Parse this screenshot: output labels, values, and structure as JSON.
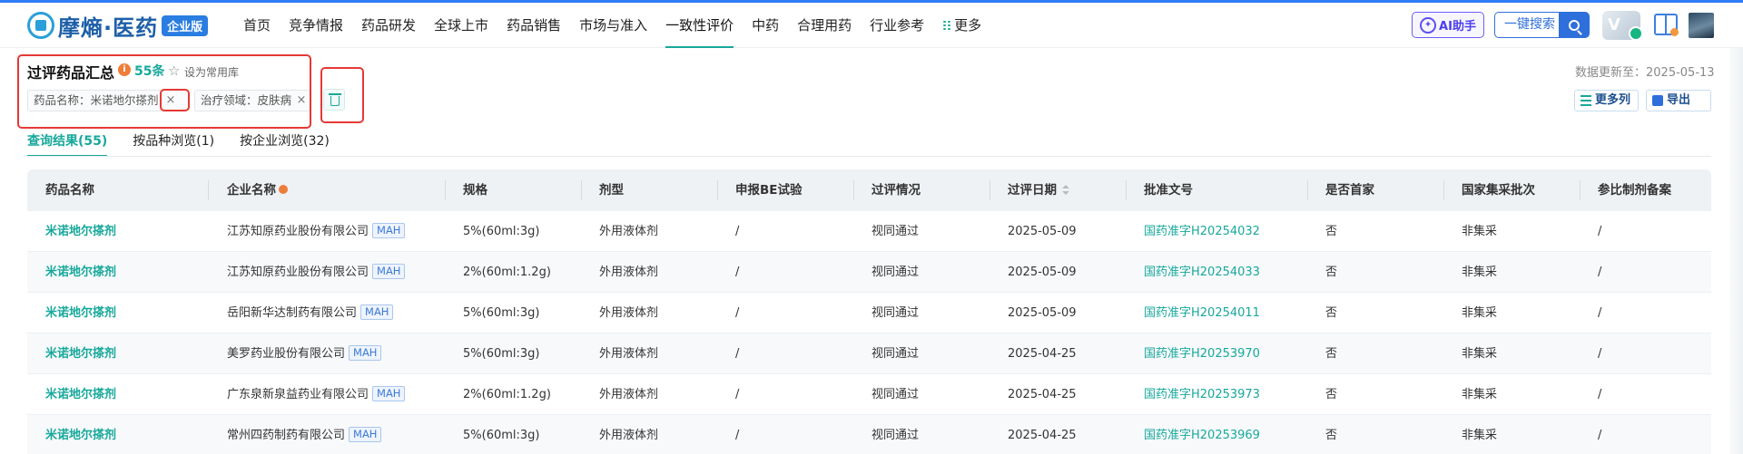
{
  "header": {
    "logo_text": "摩熵·医药",
    "logo_badge": "企业版",
    "nav": [
      {
        "label": "首页",
        "active": false
      },
      {
        "label": "竞争情报",
        "active": false
      },
      {
        "label": "药品研发",
        "active": false
      },
      {
        "label": "全球上市",
        "active": false
      },
      {
        "label": "药品销售",
        "active": false
      },
      {
        "label": "市场与准入",
        "active": false
      },
      {
        "label": "一致性评价",
        "active": true
      },
      {
        "label": "中药",
        "active": false
      },
      {
        "label": "合理用药",
        "active": false
      },
      {
        "label": "行业参考",
        "active": false
      },
      {
        "label": "更多",
        "active": false
      }
    ],
    "ai_label": "AI助手",
    "search_label": "一键搜索"
  },
  "page": {
    "title": "过评药品汇总",
    "count": "55条",
    "set_common": "设为常用库",
    "update_label": "数据更新至：2025-05-13"
  },
  "filters": {
    "chip1": "药品名称：米诺地尔搽剂",
    "chip2": "治疗领域：皮肤病",
    "close": "×"
  },
  "tools": {
    "more_cols": "更多列",
    "export": "导出"
  },
  "tabs": [
    "查询结果(55)",
    "按品种浏览(1)",
    "按企业浏览(32)"
  ],
  "table": {
    "columns": [
      "药品名称",
      "企业名称",
      "规格",
      "剂型",
      "申报BE试验",
      "过评情况",
      "过评日期",
      "批准文号",
      "是否首家",
      "国家集采批次",
      "参比制剂备案"
    ],
    "mah_label": "MAH",
    "rows": [
      [
        "米诺地尔搽剂",
        "江苏知原药业股份有限公司",
        "5%(60ml:3g)",
        "外用液体剂",
        "/",
        "视同通过",
        "2025-05-09",
        "国药准字H20254032",
        "否",
        "非集采",
        "/"
      ],
      [
        "米诺地尔搽剂",
        "江苏知原药业股份有限公司",
        "2%(60ml:1.2g)",
        "外用液体剂",
        "/",
        "视同通过",
        "2025-05-09",
        "国药准字H20254033",
        "否",
        "非集采",
        "/"
      ],
      [
        "米诺地尔搽剂",
        "岳阳新华达制药有限公司",
        "5%(60ml:3g)",
        "外用液体剂",
        "/",
        "视同通过",
        "2025-05-09",
        "国药准字H20254011",
        "否",
        "非集采",
        "/"
      ],
      [
        "米诺地尔搽剂",
        "美罗药业股份有限公司",
        "5%(60ml:3g)",
        "外用液体剂",
        "/",
        "视同通过",
        "2025-04-25",
        "国药准字H20253970",
        "否",
        "非集采",
        "/"
      ],
      [
        "米诺地尔搽剂",
        "广东泉新泉益药业有限公司",
        "2%(60ml:1.2g)",
        "外用液体剂",
        "/",
        "视同通过",
        "2025-04-25",
        "国药准字H20253973",
        "否",
        "非集采",
        "/"
      ],
      [
        "米诺地尔搽剂",
        "常州四药制药有限公司",
        "5%(60ml:3g)",
        "外用液体剂",
        "/",
        "视同通过",
        "2025-04-25",
        "国药准字H20253969",
        "否",
        "非集采",
        "/"
      ]
    ]
  }
}
